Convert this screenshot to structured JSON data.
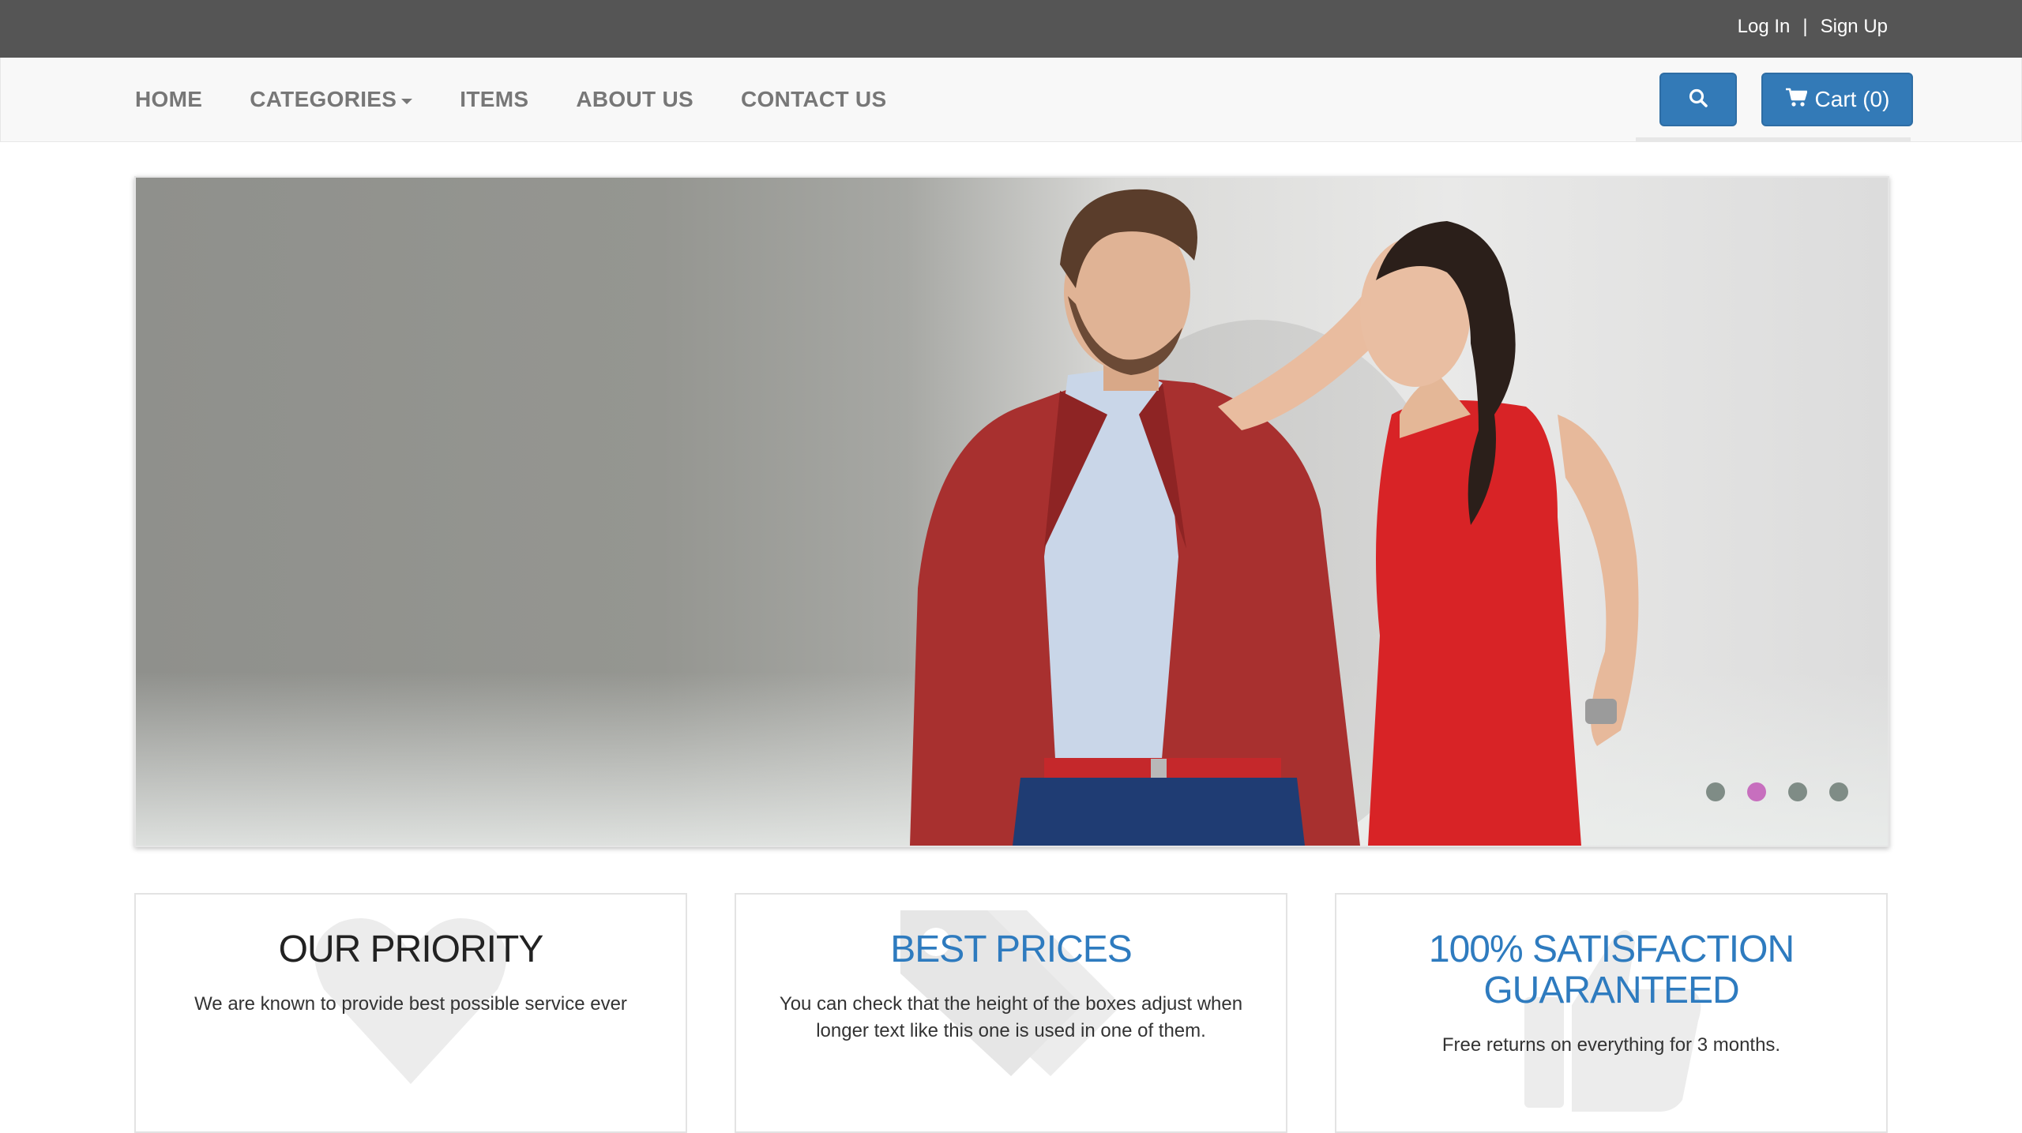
{
  "topbar": {
    "login_label": "Log In",
    "separator": "|",
    "signup_label": "Sign Up",
    "background": "#555555"
  },
  "nav": {
    "items": [
      {
        "label": "HOME"
      },
      {
        "label": "CATEGORIES",
        "has_dropdown": true
      },
      {
        "label": "ITEMS"
      },
      {
        "label": "ABOUT US"
      },
      {
        "label": "CONTACT US"
      }
    ],
    "search_icon": "search-icon",
    "cart_icon": "cart-icon",
    "cart_label": "Cart (0)",
    "accent": "#337ab7"
  },
  "carousel": {
    "slide_count": 4,
    "active_index": 1,
    "dot_color": "#7f8c86",
    "active_dot_color": "#c76fbe"
  },
  "features": [
    {
      "title": "OUR PRIORITY",
      "text": "We are known to provide best possible service ever",
      "icon": "heart-icon"
    },
    {
      "title": "BEST PRICES",
      "text": "You can check that the height of the boxes adjust when longer text like this one is used in one of them.",
      "icon": "tags-icon"
    },
    {
      "title": "100% SATISFACTION GUARANTEED",
      "text": "Free returns on everything for 3 months.",
      "icon": "thumbs-up-icon"
    }
  ]
}
